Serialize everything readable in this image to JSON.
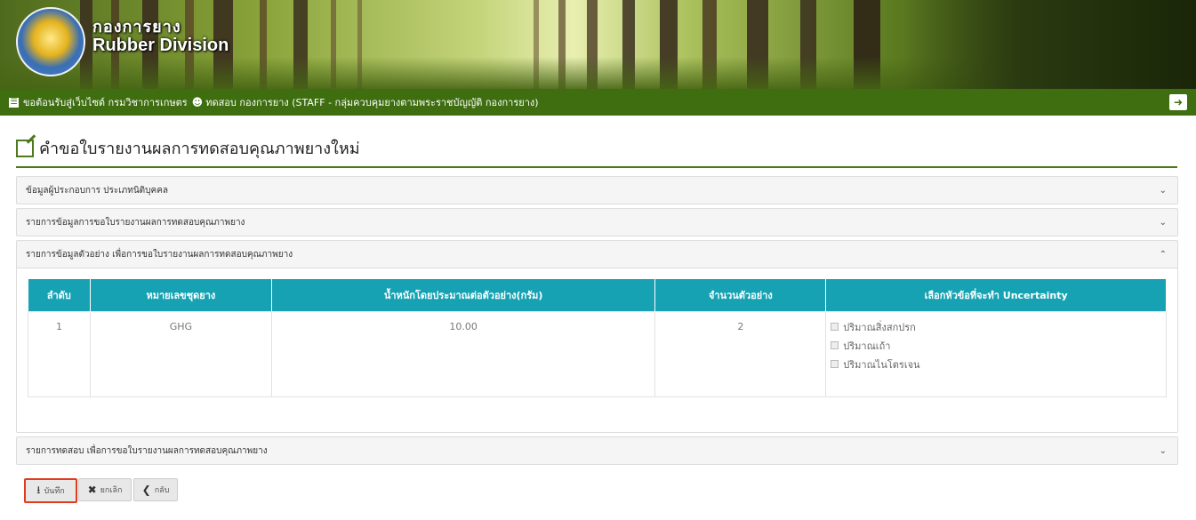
{
  "banner": {
    "logo_text_th": "กองการยาง",
    "logo_text_en": "Rubber Division",
    "logo_seal_text": "กรมวิชาการเกษตร"
  },
  "navbar": {
    "menu_icon": "list-icon",
    "welcome_text": "ขอต้อนรับสู่เว็บไซต์ กรมวิชาการเกษตร",
    "user_icon": "user-icon",
    "user_text": "ทดสอบ กองการยาง (STAFF - กลุ่มควบคุมยางตามพระราชบัญญัติ กองการยาง)",
    "logout_icon": "sign-out-icon"
  },
  "page": {
    "title": "คำขอใบรายงานผลการทดสอบคุณภาพยางใหม่",
    "title_icon": "edit-icon"
  },
  "panels": [
    {
      "title": "ข้อมูลผู้ประกอบการ ประเภทนิติบุคคล",
      "expanded": false
    },
    {
      "title": "รายการข้อมูลการขอใบรายงานผลการทดสอบคุณภาพยาง",
      "expanded": false
    },
    {
      "title": "รายการข้อมูลตัวอย่าง เพื่อการขอใบรายงานผลการทดสอบคุณภาพยาง",
      "expanded": true
    },
    {
      "title": "รายการทดสอบ เพื่อการขอใบรายงานผลการทดสอบคุณภาพยาง",
      "expanded": false
    }
  ],
  "sample_table": {
    "headers": [
      "ลำดับ",
      "หมายเลขชุดยาง",
      "น้ำหนักโดยประมาณต่อตัวอย่าง(กรัม)",
      "จำนวนตัวอย่าง",
      "เลือกหัวข้อที่จะทำ Uncertainty"
    ],
    "rows": [
      {
        "index": "1",
        "lot_no": "GHG",
        "weight": "10.00",
        "count": "2",
        "uncertainty_options": [
          "ปริมาณสิ่งสกปรก",
          "ปริมาณเถ้า",
          "ปริมาณไนโตรเจน"
        ]
      }
    ]
  },
  "buttons": {
    "save_label": "บันทึก",
    "cancel_label": "ยกเลิก",
    "back_label": "กลับ"
  },
  "colors": {
    "nav_green": "#3e6e10",
    "table_header": "#17a2b3",
    "highlight_red": "#e23a20"
  }
}
